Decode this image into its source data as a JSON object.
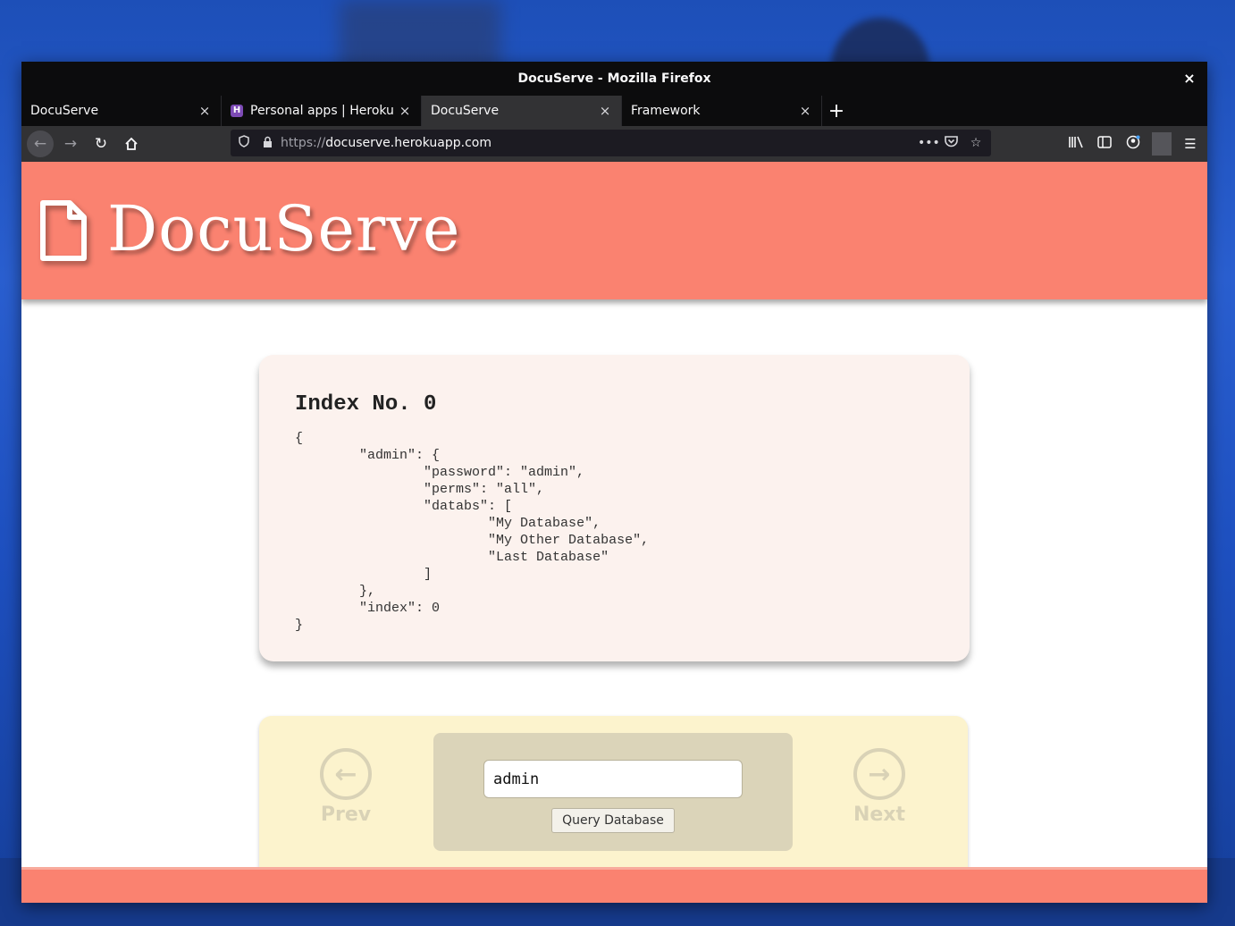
{
  "window": {
    "title": "DocuServe - Mozilla Firefox",
    "close_glyph": "×"
  },
  "tabs": [
    {
      "label": "DocuServe",
      "active": false
    },
    {
      "label": "Personal apps | Heroku",
      "active": false,
      "favicon": "heroku-icon"
    },
    {
      "label": "DocuServe",
      "active": true
    },
    {
      "label": "Framework",
      "active": false
    }
  ],
  "tab_close_glyph": "×",
  "new_tab_glyph": "+",
  "urlbar": {
    "protocol": "https://",
    "host": "docuserve.herokuapp.com"
  },
  "site": {
    "title": "DocuServe",
    "accent": "#fa8270",
    "card_bg": "#fcf2ee",
    "control_bg": "#fcf3cd"
  },
  "result": {
    "heading": "Index No. 0",
    "json_text": "{\n\t\"admin\": {\n\t\t\"password\": \"admin\",\n\t\t\"perms\": \"all\",\n\t\t\"databs\": [\n\t\t\t\"My Database\",\n\t\t\t\"My Other Database\",\n\t\t\t\"Last Database\"\n\t\t]\n\t},\n\t\"index\": 0\n}"
  },
  "controls": {
    "prev_label": "Prev",
    "next_label": "Next",
    "query_value": "admin",
    "query_button": "Query Database"
  }
}
